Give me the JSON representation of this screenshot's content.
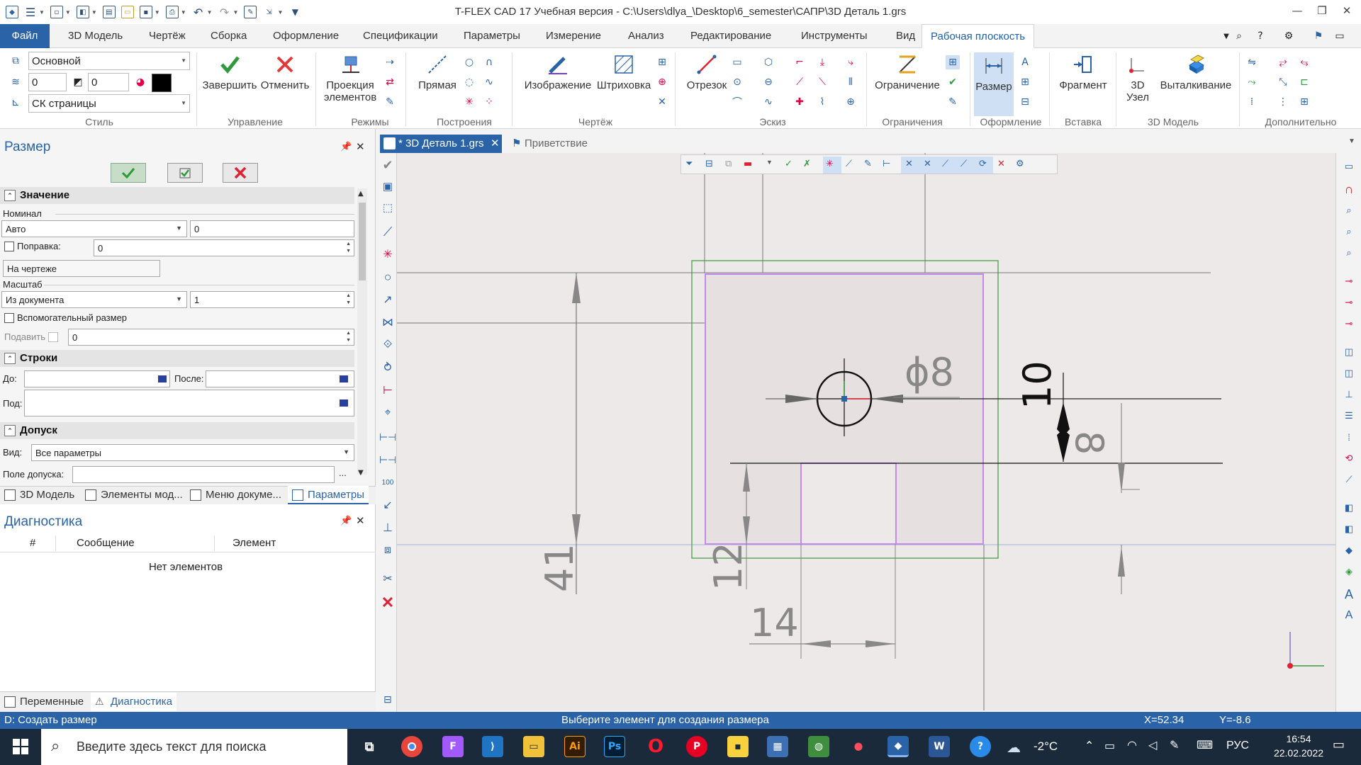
{
  "window": {
    "title": "T-FLEX CAD 17 Учебная версия - C:\\Users\\dlya_\\Desktop\\6_semester\\САПР\\3D Деталь 1.grs",
    "minimize": "—",
    "restore": "❐",
    "close": "✕"
  },
  "ribbon_tabs": [
    "Файл",
    "3D Модель",
    "Чертёж",
    "Сборка",
    "Оформление",
    "Спецификации",
    "Параметры",
    "Измерение",
    "Анализ",
    "Редактирование",
    "Инструменты",
    "Вид",
    "Рабочая плоскость"
  ],
  "style_group": {
    "style_value": "Основной",
    "layer_value": "0",
    "level_value": "0",
    "cs_value": "СК страницы",
    "label": "Стиль",
    "color": "#000000"
  },
  "groups": {
    "upravlenie": {
      "label": "Управление",
      "finish": "Завершить",
      "cancel": "Отменить"
    },
    "rezhimy": {
      "label": "Режимы",
      "projection": "Проекция элементов"
    },
    "postroeniya": {
      "label": "Построения",
      "line": "Прямая"
    },
    "chertezh": {
      "label": "Чертёж",
      "image": "Изображение",
      "hatch": "Штриховка"
    },
    "eskiz": {
      "label": "Эскиз",
      "segment": "Отрезок"
    },
    "ogranicheniya": {
      "label": "Ограничения",
      "constraint": "Ограничение"
    },
    "oformlenie": {
      "label": "Оформление",
      "dimension": "Размер"
    },
    "vstavka": {
      "label": "Вставка",
      "fragment": "Фрагмент"
    },
    "model3d": {
      "label": "3D Модель",
      "node": "3D Узел",
      "extrude": "Выталкивание"
    },
    "dop": {
      "label": "Дополнительно"
    }
  },
  "panel": {
    "title": "Размер",
    "sections": {
      "value": "Значение",
      "rows": "Строки",
      "tolerance": "Допуск"
    },
    "nominal_label": "Номинал",
    "nominal_mode": "Авто",
    "nominal_value": "0",
    "correction_label": "Поправка:",
    "correction_value": "0",
    "on_drawing": "На чертеже",
    "scale_label": "Масштаб",
    "scale_mode": "Из документа",
    "scale_value": "1",
    "aux_label": "Вспомогательный размер",
    "suppress_label": "Подавить",
    "suppress_value": "0",
    "before_label": "До:",
    "after_label": "После:",
    "under_label": "Под:",
    "view_label": "Вид:",
    "view_value": "Все параметры",
    "tol_field_label": "Поле допуска:",
    "tol_field_btn": "..."
  },
  "panel_tabs": [
    "3D Модель",
    "Элементы мод...",
    "Меню докуме...",
    "Параметры"
  ],
  "diagnostics": {
    "title": "Диагностика",
    "cols": [
      "#",
      "Сообщение",
      "Элемент"
    ],
    "empty": "Нет элементов"
  },
  "bottom_tabs": [
    "Переменные",
    "Диагностика"
  ],
  "doc_tabs": [
    "* 3D Деталь 1.grs",
    "Приветствие"
  ],
  "drawing": {
    "dim_diameter": "ϕ8",
    "dim_10": "10",
    "dim_8": "8",
    "dim_41": "41",
    "dim_12": "12",
    "dim_14": "14"
  },
  "status": {
    "left": "D: Создать размер",
    "center": "Выберите элемент для создания размера",
    "x": "X=52.34",
    "y": "Y=-8.6"
  },
  "taskbar": {
    "search_placeholder": "Введите здесь текст для поиска",
    "weather": "-2°C",
    "lang": "РУС",
    "time": "16:54",
    "date": "22.02.2022"
  }
}
